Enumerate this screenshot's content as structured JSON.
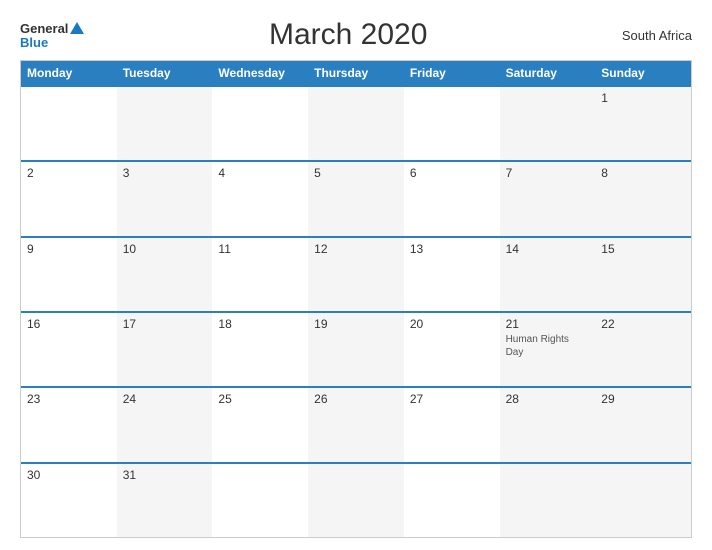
{
  "header": {
    "logo_general": "General",
    "logo_blue": "Blue",
    "title": "March 2020",
    "country": "South Africa"
  },
  "calendar": {
    "days_of_week": [
      "Monday",
      "Tuesday",
      "Wednesday",
      "Thursday",
      "Friday",
      "Saturday",
      "Sunday"
    ],
    "weeks": [
      [
        {
          "day": "",
          "events": []
        },
        {
          "day": "",
          "events": []
        },
        {
          "day": "",
          "events": []
        },
        {
          "day": "",
          "events": []
        },
        {
          "day": "",
          "events": []
        },
        {
          "day": "",
          "events": []
        },
        {
          "day": "1",
          "events": []
        }
      ],
      [
        {
          "day": "2",
          "events": []
        },
        {
          "day": "3",
          "events": []
        },
        {
          "day": "4",
          "events": []
        },
        {
          "day": "5",
          "events": []
        },
        {
          "day": "6",
          "events": []
        },
        {
          "day": "7",
          "events": []
        },
        {
          "day": "8",
          "events": []
        }
      ],
      [
        {
          "day": "9",
          "events": []
        },
        {
          "day": "10",
          "events": []
        },
        {
          "day": "11",
          "events": []
        },
        {
          "day": "12",
          "events": []
        },
        {
          "day": "13",
          "events": []
        },
        {
          "day": "14",
          "events": []
        },
        {
          "day": "15",
          "events": []
        }
      ],
      [
        {
          "day": "16",
          "events": []
        },
        {
          "day": "17",
          "events": []
        },
        {
          "day": "18",
          "events": []
        },
        {
          "day": "19",
          "events": []
        },
        {
          "day": "20",
          "events": []
        },
        {
          "day": "21",
          "events": [
            "Human Rights Day"
          ]
        },
        {
          "day": "22",
          "events": []
        }
      ],
      [
        {
          "day": "23",
          "events": []
        },
        {
          "day": "24",
          "events": []
        },
        {
          "day": "25",
          "events": []
        },
        {
          "day": "26",
          "events": []
        },
        {
          "day": "27",
          "events": []
        },
        {
          "day": "28",
          "events": []
        },
        {
          "day": "29",
          "events": []
        }
      ],
      [
        {
          "day": "30",
          "events": []
        },
        {
          "day": "31",
          "events": []
        },
        {
          "day": "",
          "events": []
        },
        {
          "day": "",
          "events": []
        },
        {
          "day": "",
          "events": []
        },
        {
          "day": "",
          "events": []
        },
        {
          "day": "",
          "events": []
        }
      ]
    ]
  }
}
